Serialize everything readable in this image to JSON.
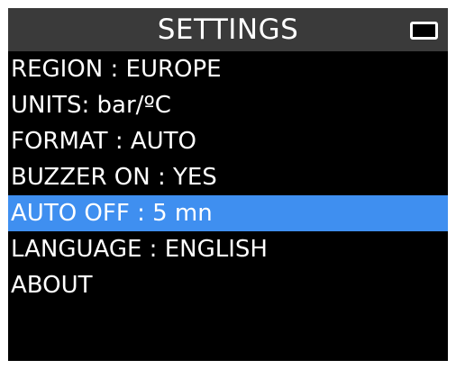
{
  "header": {
    "title": "SETTINGS",
    "battery_icon": "battery-icon"
  },
  "menu": {
    "items": [
      {
        "label": "REGION : EUROPE"
      },
      {
        "label": "UNITS: bar/ºC"
      },
      {
        "label": "FORMAT : AUTO"
      },
      {
        "label": "BUZZER ON : YES"
      },
      {
        "label": "AUTO OFF : 5 mn",
        "selected": true
      },
      {
        "label": "LANGUAGE : ENGLISH"
      },
      {
        "label": "ABOUT"
      }
    ]
  },
  "colors": {
    "screen_background": "#000000",
    "title_bar": "#3a3a3a",
    "selection_highlight": "#3f8ff0",
    "text": "#ffffff"
  }
}
